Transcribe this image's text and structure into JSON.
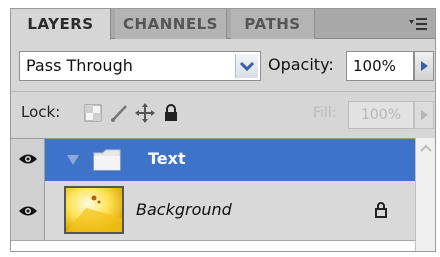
{
  "tabs": [
    {
      "label": "LAYERS",
      "active": true
    },
    {
      "label": "CHANNELS",
      "active": false
    },
    {
      "label": "PATHS",
      "active": false
    }
  ],
  "panel_menu_icon": "panel-menu-icon",
  "blend_mode": {
    "value": "Pass Through"
  },
  "opacity": {
    "label": "Opacity:",
    "value": "100%"
  },
  "lock": {
    "label": "Lock:",
    "icons": [
      "lock-transparent-pixels-icon",
      "lock-image-pixels-icon",
      "lock-position-icon",
      "lock-all-icon"
    ]
  },
  "fill": {
    "label": "Fill:",
    "value": "100%"
  },
  "layers": [
    {
      "name": "Text",
      "type": "group",
      "selected": true,
      "visible": true,
      "icon": "folder-icon"
    },
    {
      "name": "Background",
      "type": "image",
      "selected": false,
      "visible": true,
      "locked": true,
      "icon": "lock-icon"
    }
  ],
  "colors": {
    "selection": "#3f73c9",
    "panel": "#d6d6d6",
    "tab_bar": "#a9a9a9"
  }
}
